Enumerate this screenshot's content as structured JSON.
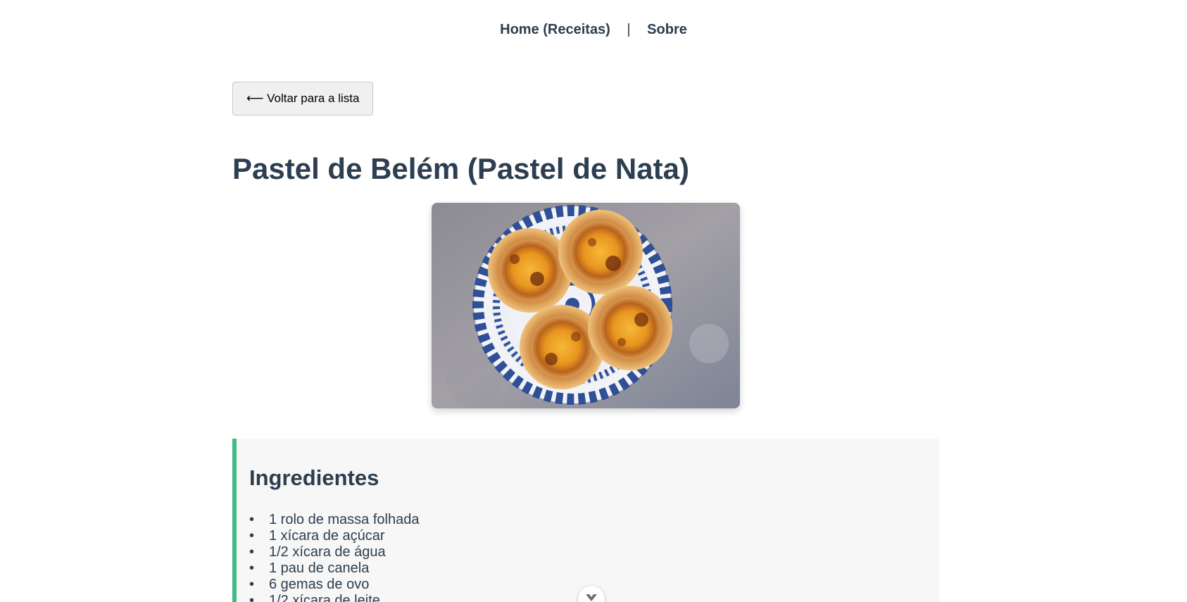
{
  "nav": {
    "home_label": "Home (Receitas)",
    "separator": "|",
    "about_label": "Sobre"
  },
  "back_button": {
    "label": "⟵ Voltar para a lista"
  },
  "recipe": {
    "title": "Pastel de Belém (Pastel de Nata)",
    "image_icon": "pasteis-de-nata-photo"
  },
  "ingredients": {
    "title": "Ingredientes",
    "bullet": "•",
    "items": [
      "1 rolo de massa folhada",
      "1 xícara de açúcar",
      "1/2 xícara de água",
      "1 pau de canela",
      "6 gemas de ovo",
      "1/2 xícara de leite"
    ]
  },
  "scroll_button": {
    "icon": "chevron-down-icon"
  },
  "colors": {
    "text": "#2c3e50",
    "accent": "#42b983",
    "panel_bg": "#f7f7f7",
    "button_bg": "#f0f0f0"
  }
}
